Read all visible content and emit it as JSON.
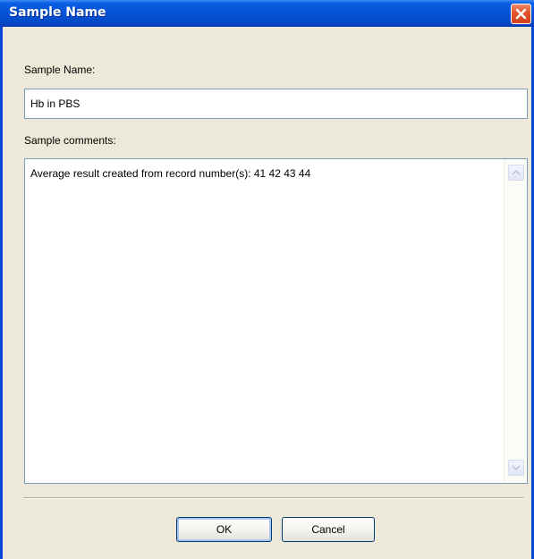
{
  "window": {
    "title": "Sample Name"
  },
  "form": {
    "name_label": "Sample Name:",
    "name_value": "Hb in PBS",
    "comments_label": "Sample comments:",
    "comments_value": "Average result created from record number(s): 41 42 43 44"
  },
  "buttons": {
    "ok_label": "OK",
    "cancel_label": "Cancel"
  },
  "icons": {
    "close": "close-icon",
    "scroll_up": "scroll-up-arrow-icon",
    "scroll_down": "scroll-down-arrow-icon"
  },
  "colors": {
    "title_bar": "#0552d6",
    "close_button": "#d3401c",
    "dialog_background": "#ece9d8",
    "input_border": "#7f9db9"
  }
}
